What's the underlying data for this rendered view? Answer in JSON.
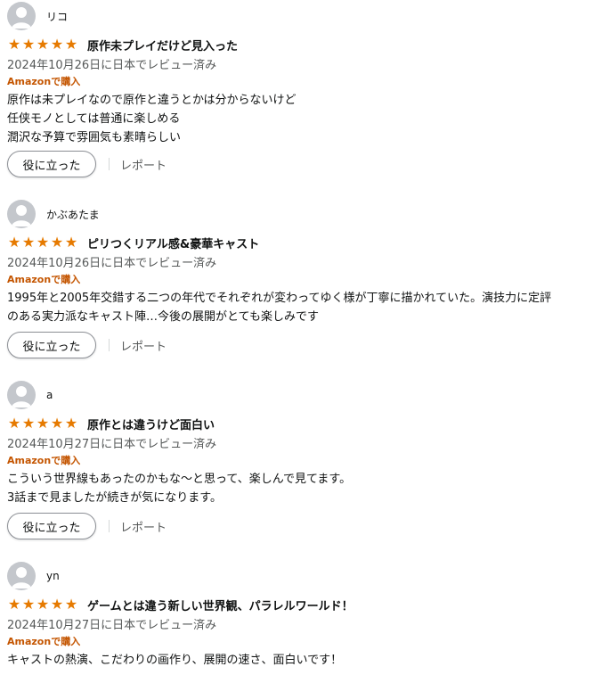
{
  "colors": {
    "star": "#e67a00",
    "badge": "#c45500",
    "meta": "#565959"
  },
  "reviews": [
    {
      "username": "リコ",
      "rating": 5,
      "title": "原作未プレイだけど見入った",
      "date": "2024年10月26日に日本でレビュー済み",
      "badge": "Amazonで購入",
      "lines": [
        "原作は未プレイなので原作と違うとかは分からないけど",
        "任侠モノとしては普通に楽しめる",
        "潤沢な予算で雰囲気も素晴らしい"
      ],
      "helpful_label": "役に立った",
      "report_label": "レポート"
    },
    {
      "username": "かぶあたま",
      "rating": 5,
      "title": "ピリつくリアル感&豪華キャスト",
      "date": "2024年10月26日に日本でレビュー済み",
      "badge": "Amazonで購入",
      "lines": [
        "1995年と2005年交錯する二つの年代でそれぞれが変わってゆく様が丁寧に描かれていた。演技力に定評",
        "のある実力派なキャスト陣…今後の展開がとても楽しみです"
      ],
      "helpful_label": "役に立った",
      "report_label": "レポート"
    },
    {
      "username": "a",
      "rating": 5,
      "title": "原作とは違うけど面白い",
      "date": "2024年10月27日に日本でレビュー済み",
      "badge": "Amazonで購入",
      "lines": [
        "こういう世界線もあったのかもな〜と思って、楽しんで見てます。",
        "3話まで見ましたが続きが気になります。"
      ],
      "helpful_label": "役に立った",
      "report_label": "レポート"
    },
    {
      "username": "yn",
      "rating": 5,
      "title": "ゲームとは違う新しい世界観、パラレルワールド！",
      "date": "2024年10月27日に日本でレビュー済み",
      "badge": "Amazonで購入",
      "lines": [
        "キャストの熱演、こだわりの画作り、展開の速さ、面白いです！"
      ]
    }
  ]
}
